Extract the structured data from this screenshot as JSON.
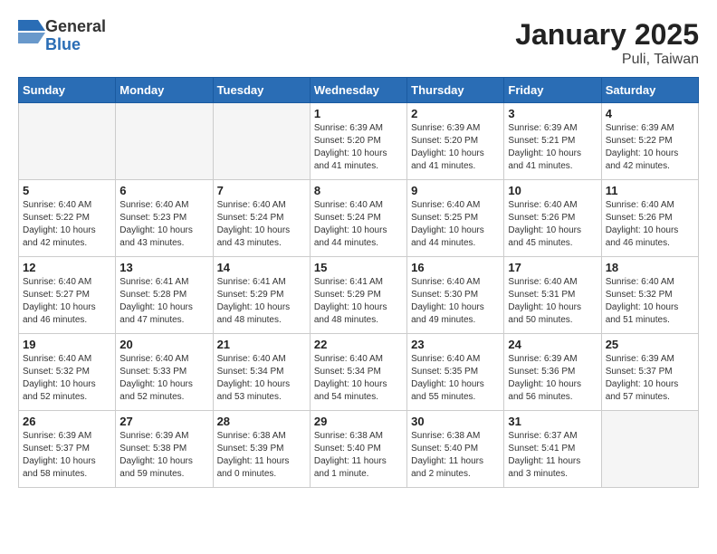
{
  "logo": {
    "general": "General",
    "blue": "Blue"
  },
  "title": "January 2025",
  "subtitle": "Puli, Taiwan",
  "days_of_week": [
    "Sunday",
    "Monday",
    "Tuesday",
    "Wednesday",
    "Thursday",
    "Friday",
    "Saturday"
  ],
  "weeks": [
    [
      {
        "day": "",
        "info": ""
      },
      {
        "day": "",
        "info": ""
      },
      {
        "day": "",
        "info": ""
      },
      {
        "day": "1",
        "info": "Sunrise: 6:39 AM\nSunset: 5:20 PM\nDaylight: 10 hours\nand 41 minutes."
      },
      {
        "day": "2",
        "info": "Sunrise: 6:39 AM\nSunset: 5:20 PM\nDaylight: 10 hours\nand 41 minutes."
      },
      {
        "day": "3",
        "info": "Sunrise: 6:39 AM\nSunset: 5:21 PM\nDaylight: 10 hours\nand 41 minutes."
      },
      {
        "day": "4",
        "info": "Sunrise: 6:39 AM\nSunset: 5:22 PM\nDaylight: 10 hours\nand 42 minutes."
      }
    ],
    [
      {
        "day": "5",
        "info": "Sunrise: 6:40 AM\nSunset: 5:22 PM\nDaylight: 10 hours\nand 42 minutes."
      },
      {
        "day": "6",
        "info": "Sunrise: 6:40 AM\nSunset: 5:23 PM\nDaylight: 10 hours\nand 43 minutes."
      },
      {
        "day": "7",
        "info": "Sunrise: 6:40 AM\nSunset: 5:24 PM\nDaylight: 10 hours\nand 43 minutes."
      },
      {
        "day": "8",
        "info": "Sunrise: 6:40 AM\nSunset: 5:24 PM\nDaylight: 10 hours\nand 44 minutes."
      },
      {
        "day": "9",
        "info": "Sunrise: 6:40 AM\nSunset: 5:25 PM\nDaylight: 10 hours\nand 44 minutes."
      },
      {
        "day": "10",
        "info": "Sunrise: 6:40 AM\nSunset: 5:26 PM\nDaylight: 10 hours\nand 45 minutes."
      },
      {
        "day": "11",
        "info": "Sunrise: 6:40 AM\nSunset: 5:26 PM\nDaylight: 10 hours\nand 46 minutes."
      }
    ],
    [
      {
        "day": "12",
        "info": "Sunrise: 6:40 AM\nSunset: 5:27 PM\nDaylight: 10 hours\nand 46 minutes."
      },
      {
        "day": "13",
        "info": "Sunrise: 6:41 AM\nSunset: 5:28 PM\nDaylight: 10 hours\nand 47 minutes."
      },
      {
        "day": "14",
        "info": "Sunrise: 6:41 AM\nSunset: 5:29 PM\nDaylight: 10 hours\nand 48 minutes."
      },
      {
        "day": "15",
        "info": "Sunrise: 6:41 AM\nSunset: 5:29 PM\nDaylight: 10 hours\nand 48 minutes."
      },
      {
        "day": "16",
        "info": "Sunrise: 6:40 AM\nSunset: 5:30 PM\nDaylight: 10 hours\nand 49 minutes."
      },
      {
        "day": "17",
        "info": "Sunrise: 6:40 AM\nSunset: 5:31 PM\nDaylight: 10 hours\nand 50 minutes."
      },
      {
        "day": "18",
        "info": "Sunrise: 6:40 AM\nSunset: 5:32 PM\nDaylight: 10 hours\nand 51 minutes."
      }
    ],
    [
      {
        "day": "19",
        "info": "Sunrise: 6:40 AM\nSunset: 5:32 PM\nDaylight: 10 hours\nand 52 minutes."
      },
      {
        "day": "20",
        "info": "Sunrise: 6:40 AM\nSunset: 5:33 PM\nDaylight: 10 hours\nand 52 minutes."
      },
      {
        "day": "21",
        "info": "Sunrise: 6:40 AM\nSunset: 5:34 PM\nDaylight: 10 hours\nand 53 minutes."
      },
      {
        "day": "22",
        "info": "Sunrise: 6:40 AM\nSunset: 5:34 PM\nDaylight: 10 hours\nand 54 minutes."
      },
      {
        "day": "23",
        "info": "Sunrise: 6:40 AM\nSunset: 5:35 PM\nDaylight: 10 hours\nand 55 minutes."
      },
      {
        "day": "24",
        "info": "Sunrise: 6:39 AM\nSunset: 5:36 PM\nDaylight: 10 hours\nand 56 minutes."
      },
      {
        "day": "25",
        "info": "Sunrise: 6:39 AM\nSunset: 5:37 PM\nDaylight: 10 hours\nand 57 minutes."
      }
    ],
    [
      {
        "day": "26",
        "info": "Sunrise: 6:39 AM\nSunset: 5:37 PM\nDaylight: 10 hours\nand 58 minutes."
      },
      {
        "day": "27",
        "info": "Sunrise: 6:39 AM\nSunset: 5:38 PM\nDaylight: 10 hours\nand 59 minutes."
      },
      {
        "day": "28",
        "info": "Sunrise: 6:38 AM\nSunset: 5:39 PM\nDaylight: 11 hours\nand 0 minutes."
      },
      {
        "day": "29",
        "info": "Sunrise: 6:38 AM\nSunset: 5:40 PM\nDaylight: 11 hours\nand 1 minute."
      },
      {
        "day": "30",
        "info": "Sunrise: 6:38 AM\nSunset: 5:40 PM\nDaylight: 11 hours\nand 2 minutes."
      },
      {
        "day": "31",
        "info": "Sunrise: 6:37 AM\nSunset: 5:41 PM\nDaylight: 11 hours\nand 3 minutes."
      },
      {
        "day": "",
        "info": ""
      }
    ]
  ]
}
